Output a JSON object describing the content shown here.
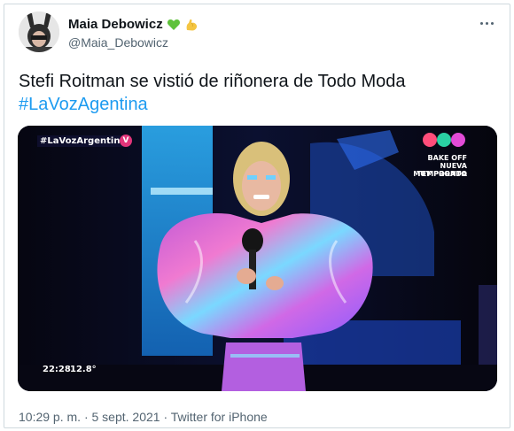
{
  "user": {
    "name": "Maia Debowicz",
    "handle": "@Maia_Debowicz",
    "emojis": [
      "green-heart-icon",
      "flexed-biceps-icon"
    ]
  },
  "tweet": {
    "text": "Stefi Roitman se vistió de riñonera de Todo Moda",
    "hashtag": "#LaVozAgentina"
  },
  "media": {
    "channel_hashtag": "#LaVozArgentina",
    "promo_line1": "BAKE OFF",
    "promo_line2": "NUEVA TEMPORADA",
    "promo_line3": "MUY PRONTO",
    "clock": "22:28",
    "temperature": "12.8°"
  },
  "meta": {
    "time": "10:29 p. m.",
    "separator": "·",
    "date": "5 sept. 2021",
    "source": "Twitter for iPhone"
  },
  "colors": {
    "link": "#1d9bf0",
    "secondary_text": "#536471",
    "border": "#cfd9de"
  }
}
